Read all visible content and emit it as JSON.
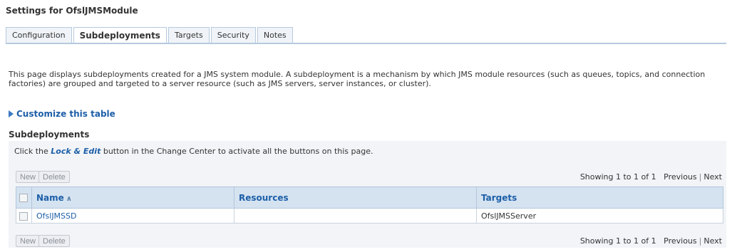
{
  "header": {
    "title": "Settings for OfslJMSModule"
  },
  "tabs": [
    {
      "label": "Configuration",
      "active": false
    },
    {
      "label": "Subdeployments",
      "active": true
    },
    {
      "label": "Targets",
      "active": false
    },
    {
      "label": "Security",
      "active": false
    },
    {
      "label": "Notes",
      "active": false
    }
  ],
  "description": "This page displays subdeployments created for a JMS system module. A subdeployment is a mechanism by which JMS module resources (such as queues, topics, and connection factories) are grouped and targeted to a server resource (such as JMS servers, server instances, or cluster).",
  "customize": {
    "label": "Customize this table",
    "icon": "expand-triangle-icon"
  },
  "section": {
    "title": "Subdeployments"
  },
  "lock_message": {
    "prefix": "Click the ",
    "lock": "Lock & Edit",
    "suffix": " button in the Change Center to activate all the buttons on this page."
  },
  "buttons": {
    "new_label": "New",
    "delete_label": "Delete"
  },
  "pager": {
    "showing": "Showing 1 to 1 of 1",
    "previous": "Previous",
    "separator": "|",
    "next": "Next"
  },
  "table": {
    "columns": {
      "name": "Name",
      "resources": "Resources",
      "targets": "Targets"
    },
    "sort_icon": "sort-ascending-icon",
    "rows": [
      {
        "name": "OfslJMSSD",
        "resources": "",
        "targets": "OfslJMSServer"
      }
    ]
  },
  "colors": {
    "accent": "#1d5fa8",
    "header_bg": "#d5e3f1",
    "panel_bg": "#f2f4f7"
  }
}
